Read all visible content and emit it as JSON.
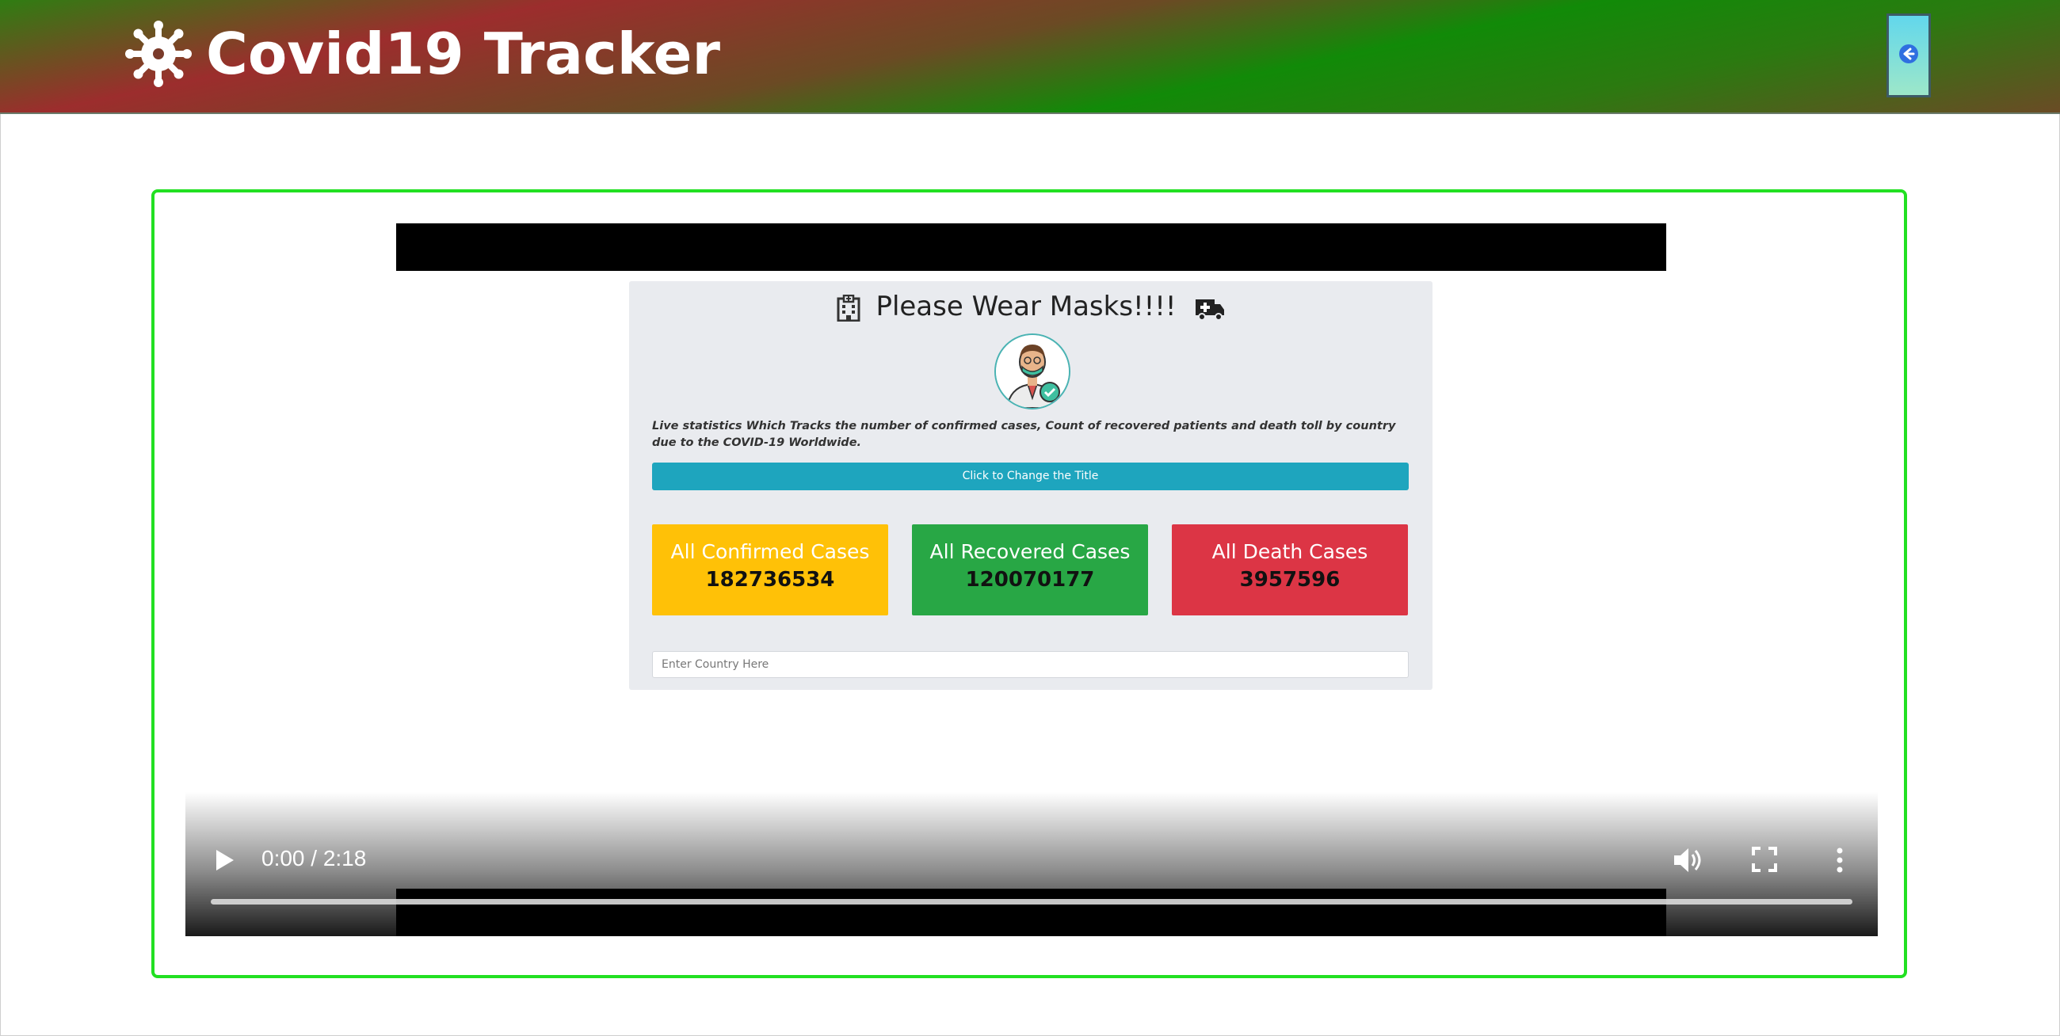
{
  "header": {
    "title": "Covid19 Tracker",
    "logo_icon": "virus-icon",
    "back_icon": "arrow-left-circle-icon"
  },
  "video": {
    "time": "0:00 / 2:18",
    "play_icon": "play-icon",
    "volume_icon": "volume-icon",
    "fullscreen_icon": "fullscreen-icon",
    "more_icon": "more-vertical-icon",
    "progress": 0.0,
    "frame": {
      "title": "Please Wear Masks!!!!",
      "title_icon_left": "hospital-icon",
      "title_icon_right": "ambulance-icon",
      "avatar_icon": "masked-doctor-avatar-icon",
      "description": "Live statistics Which Tracks the number of confirmed cases, Count of recovered patients and death toll by country due to the COVID-19 Worldwide.",
      "change_title_button": "Click to Change the Title",
      "stats": [
        {
          "label": "All Confirmed Cases",
          "value": "182736534"
        },
        {
          "label": "All Recovered Cases",
          "value": "120070177"
        },
        {
          "label": "All Death Cases",
          "value": "3957596"
        }
      ],
      "country_placeholder": "Enter Country Here"
    }
  },
  "colors": {
    "frame_border": "#22e022",
    "confirmed": "#ffc107",
    "recovered": "#28a745",
    "death": "#dc3545",
    "change_button": "#1ea5be"
  }
}
